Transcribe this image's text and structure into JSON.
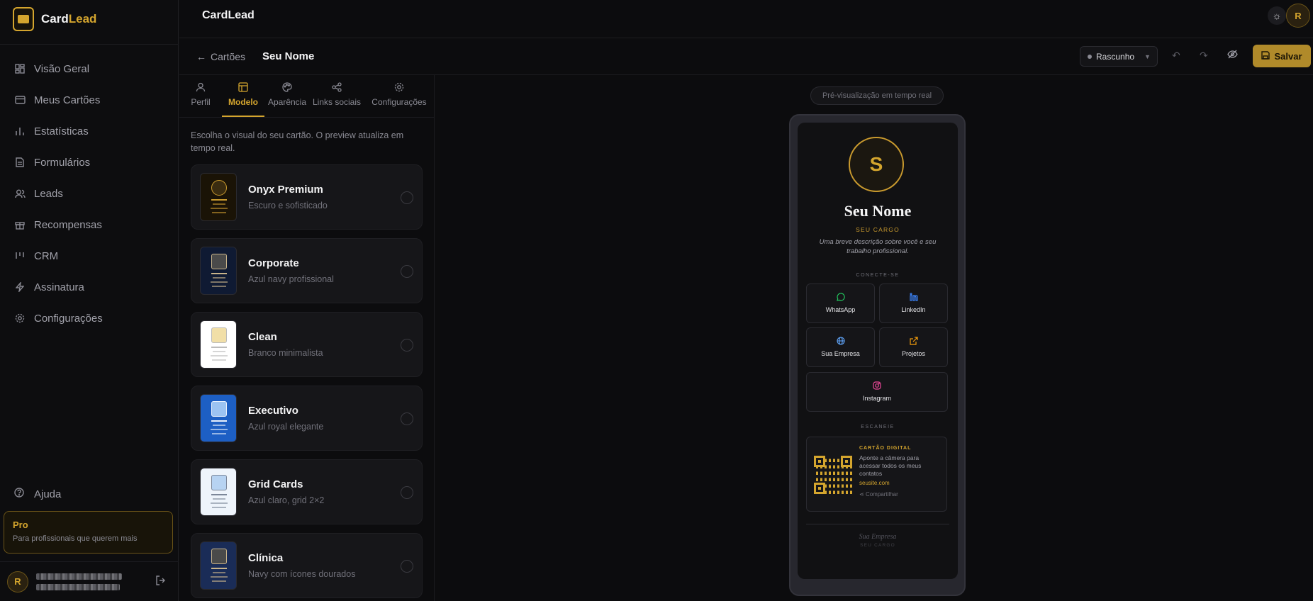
{
  "app": {
    "brand_a": "Card",
    "brand_b": "Lead",
    "title": "CardLead",
    "accent": "#d4a52e"
  },
  "sidebar": {
    "items": [
      {
        "label": "Visão Geral",
        "icon": "grid-icon"
      },
      {
        "label": "Meus Cartões",
        "icon": "card-icon"
      },
      {
        "label": "Estatísticas",
        "icon": "chart-icon"
      },
      {
        "label": "Formulários",
        "icon": "file-icon"
      },
      {
        "label": "Leads",
        "icon": "users-icon"
      },
      {
        "label": "Recompensas",
        "icon": "gift-icon"
      },
      {
        "label": "CRM",
        "icon": "kanban-icon"
      },
      {
        "label": "Assinatura",
        "icon": "bolt-icon"
      },
      {
        "label": "Configurações",
        "icon": "gear-icon"
      }
    ],
    "help": "Ajuda",
    "plan": {
      "title": "Pro",
      "subtitle": "Para profissionais que querem mais"
    },
    "user_initial": "R"
  },
  "header": {
    "avatar": "R"
  },
  "editor": {
    "back": "Cartões",
    "doc_name": "Seu Nome",
    "status": "Rascunho",
    "save": "Salvar",
    "tabs": [
      {
        "label": "Perfil",
        "icon": "user-icon"
      },
      {
        "label": "Modelo",
        "icon": "layout-icon",
        "active": true
      },
      {
        "label": "Aparência",
        "icon": "palette-icon"
      },
      {
        "label": "Links sociais",
        "icon": "share-icon"
      },
      {
        "label": "Configurações",
        "icon": "gear-icon"
      }
    ],
    "hint": "Escolha o visual do seu cartão. O preview atualiza em tempo real.",
    "templates": [
      {
        "name": "Onyx Premium",
        "desc": "Escuro e sofisticado",
        "bg": "#1a1306",
        "ph": "#3a2c10",
        "line": "#c99a2e"
      },
      {
        "name": "Corporate",
        "desc": "Azul navy profissional",
        "bg": "#0f1a33",
        "ph": "#4a4a4a",
        "line": "#c9b48a"
      },
      {
        "name": "Clean",
        "desc": "Branco minimalista",
        "bg": "#ffffff",
        "ph": "#f1dfa8",
        "line": "#bbbbbb"
      },
      {
        "name": "Executivo",
        "desc": "Azul royal elegante",
        "bg": "#1d5fc4",
        "ph": "#9cc3f2",
        "line": "#e8f0fc"
      },
      {
        "name": "Grid Cards",
        "desc": "Azul claro, grid 2×2",
        "bg": "#eef4fb",
        "ph": "#b7d3f2",
        "line": "#7c8799"
      },
      {
        "name": "Clínica",
        "desc": "Navy com ícones dourados",
        "bg": "#1a2c57",
        "ph": "#4a4a4a",
        "line": "#c9b48a"
      }
    ]
  },
  "preview": {
    "badge": "Pré-visualização em tempo real",
    "initial": "S",
    "name": "Seu Nome",
    "role": "SEU CARGO",
    "bio": "Uma breve descrição sobre você e seu trabalho profissional.",
    "connect": "CONECTE-SE",
    "links": [
      {
        "label": "WhatsApp",
        "icon": "whatsapp-icon",
        "color": "#22c55e"
      },
      {
        "label": "LinkedIn",
        "icon": "linkedin-icon",
        "color": "#3b82f6"
      },
      {
        "label": "Sua Empresa",
        "icon": "globe-icon",
        "color": "#60a5fa"
      },
      {
        "label": "Projetos",
        "icon": "external-link-icon",
        "color": "#f59e0b"
      },
      {
        "label": "Instagram",
        "icon": "instagram-icon",
        "color": "#ec4899"
      }
    ],
    "scan": "ESCANEIE",
    "qr": {
      "title": "CARTÃO DIGITAL",
      "desc": "Aponte a câmera para acessar todos os meus contatos",
      "url": "seusite.com",
      "share": "Compartilhar"
    },
    "footer_company": "Sua Empresa",
    "footer_role": "SEU CARGO"
  }
}
